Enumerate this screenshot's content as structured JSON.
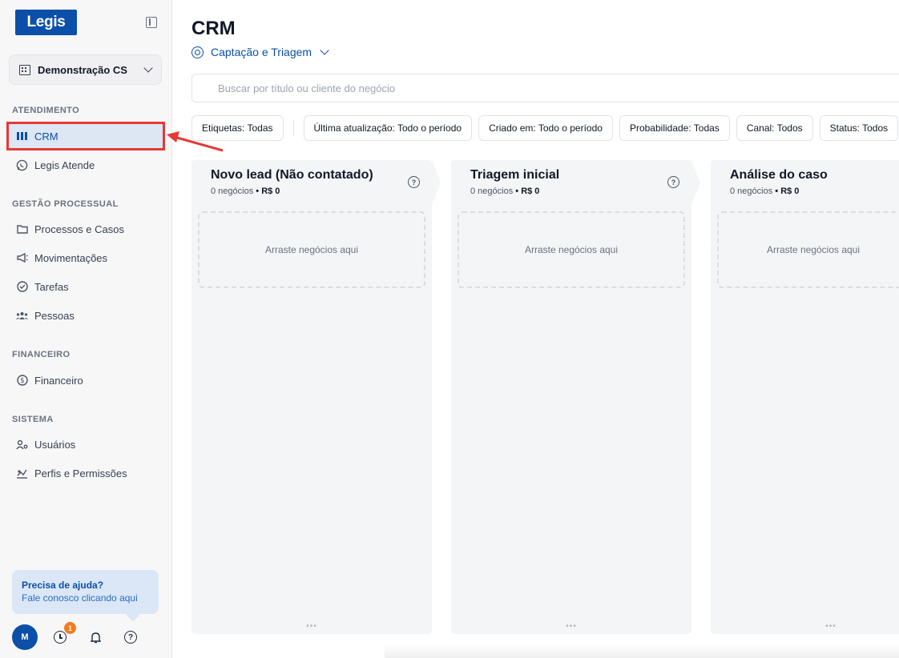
{
  "brand": {
    "logo_text": "Legis",
    "accent": "#0b4fa8"
  },
  "workspace": {
    "name": "Demonstração CS"
  },
  "sidebar": {
    "sections": [
      {
        "label": "ATENDIMENTO",
        "items": [
          {
            "label": "CRM",
            "icon": "columns-icon",
            "active": true
          },
          {
            "label": "Legis Atende",
            "icon": "whatsapp-icon"
          }
        ]
      },
      {
        "label": "GESTÃO PROCESSUAL",
        "items": [
          {
            "label": "Processos e Casos",
            "icon": "folder-icon"
          },
          {
            "label": "Movimentações",
            "icon": "megaphone-icon"
          },
          {
            "label": "Tarefas",
            "icon": "check-circle-icon"
          },
          {
            "label": "Pessoas",
            "icon": "people-icon"
          }
        ]
      },
      {
        "label": "FINANCEIRO",
        "items": [
          {
            "label": "Financeiro",
            "icon": "dollar-circle-icon"
          }
        ]
      },
      {
        "label": "SISTEMA",
        "items": [
          {
            "label": "Usuários",
            "icon": "user-gear-icon"
          },
          {
            "label": "Perfis e Permissões",
            "icon": "shield-key-icon"
          }
        ]
      }
    ],
    "help": {
      "title": "Precisa de ajuda?",
      "subtitle": "Fale conosco clicando aqui"
    },
    "footer": {
      "avatar_initial": "M",
      "notification_count": "1"
    }
  },
  "main": {
    "title": "CRM",
    "pipeline": "Captação e Triagem",
    "search_placeholder": "Buscar por título ou cliente do negócio",
    "filters": [
      "Etiquetas: Todas",
      "Última atualização: Todo o período",
      "Criado em: Todo o período",
      "Probabilidade: Todas",
      "Canal: Todos",
      "Status: Todos"
    ],
    "columns": [
      {
        "title": "Novo lead (Não contatado)",
        "count": "0 negócios",
        "amount": "• R$ 0",
        "drop_text": "Arraste negócios aqui"
      },
      {
        "title": "Triagem inicial",
        "count": "0 negócios",
        "amount": "• R$ 0",
        "drop_text": "Arraste negócios aqui"
      },
      {
        "title": "Análise do caso",
        "count": "0 negócios",
        "amount": "• R$ 0",
        "drop_text": "Arraste negócios aqui"
      }
    ]
  },
  "annotation": {
    "color": "#e53935"
  }
}
